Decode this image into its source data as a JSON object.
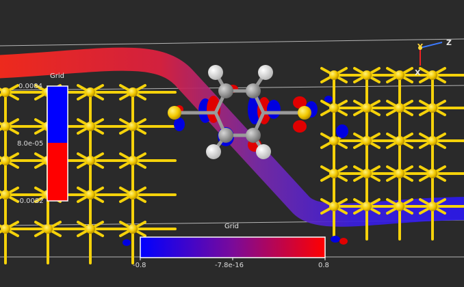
{
  "viewer": {
    "axes": {
      "z_label": "Z",
      "y_label": "Y",
      "x_label": "X"
    },
    "vertical_legend": {
      "title": "Grid",
      "top_label": "0.0084",
      "mid_label": "8.0e-05",
      "bottom_label": "-0.0082",
      "top_color": "#0000ff",
      "bottom_color": "#ff0000"
    },
    "horizontal_legend": {
      "title": "Grid",
      "left_label": "-0.8",
      "mid_label": "-7.8e-16",
      "right_label": "0.8",
      "start_color": "#0000ff",
      "end_color": "#ff0000"
    },
    "colors": {
      "background": "#2a2a2a",
      "gold": "#f5d20a",
      "positive_lobe": "#e00000",
      "negative_lobe": "#0000e0",
      "carbon": "#8c8c8c",
      "hydrogen": "#f0f0f0"
    }
  }
}
